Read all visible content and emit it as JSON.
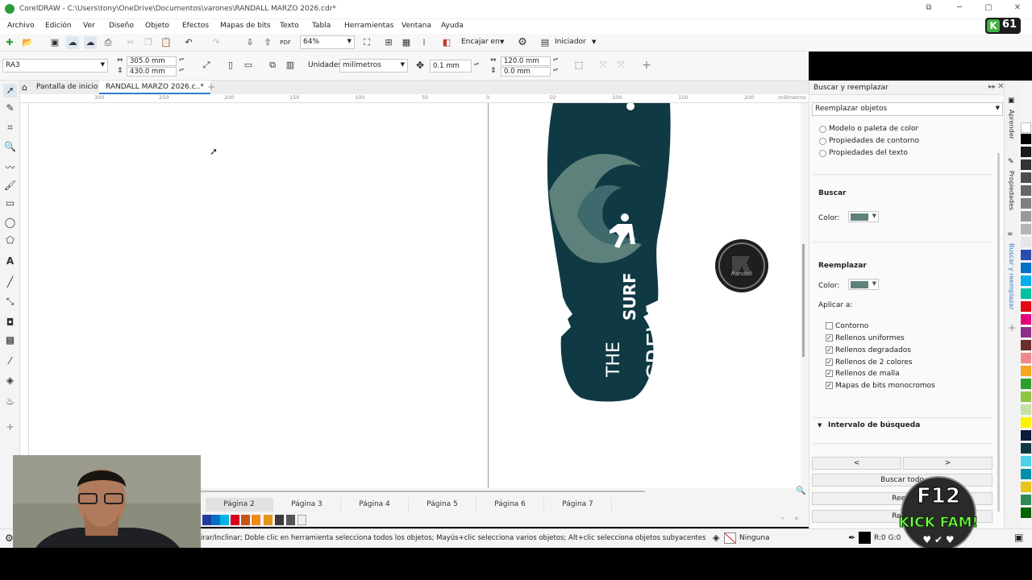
{
  "window": {
    "title": "CorelDRAW - C:\\Users\\tony\\OneDrive\\Documentos\\varones\\RANDALL MARZO 2026.cdr*"
  },
  "menu": [
    "Archivo",
    "Edición",
    "Ver",
    "Diseño",
    "Objeto",
    "Efectos",
    "Mapas de bits",
    "Texto",
    "Tabla",
    "Herramientas",
    "Ventana",
    "Ayuda"
  ],
  "badge": {
    "letter": "K",
    "count": "61"
  },
  "standard": {
    "zoom": "64%",
    "snap_label": "Encajar en",
    "launch_label": "Iniciador"
  },
  "property": {
    "paper": "RA3",
    "width": "305.0 mm",
    "height": "430.0 mm",
    "units_label": "Unidades:",
    "units": "milímetros",
    "nudge": "0.1 mm",
    "dup_x": "120.0 mm",
    "dup_y": "0.0 mm"
  },
  "doc_tabs": {
    "home": "Pantalla de inicio",
    "active": "RANDALL MARZO 2026.c..*"
  },
  "ruler": {
    "unit": "milímetros",
    "ticks": [
      "300",
      "250",
      "200",
      "150",
      "100",
      "50",
      "0",
      "50",
      "100",
      "150",
      "200"
    ]
  },
  "artwork": {
    "line1": "THE",
    "line2": "SURF",
    "line3": "CREW",
    "logo_text": "Randall"
  },
  "pages": [
    "Página 2",
    "Página 3",
    "Página 4",
    "Página 5",
    "Página 6",
    "Página 7"
  ],
  "status": {
    "hint": "irar/Inclinar; Doble clic en herramienta selecciona todos los objetos; Mayús+clic selecciona varios objetos; Alt+clic selecciona objetos subyacentes",
    "fill": "Ninguna",
    "rgb": "R:0 G:0"
  },
  "docker": {
    "title": "Buscar y reemplazar",
    "mode": "Reemplazar objetos",
    "options": [
      "Modelo o paleta de color",
      "Propiedades de contorno",
      "Propiedades del texto"
    ],
    "find_heading": "Buscar",
    "find_color_label": "Color:",
    "replace_heading": "Reemplazar",
    "replace_color_label": "Color:",
    "apply_label": "Aplicar a:",
    "apply": [
      {
        "label": "Contorno",
        "checked": false
      },
      {
        "label": "Rellenos uniformes",
        "checked": true
      },
      {
        "label": "Rellenos degradados",
        "checked": true
      },
      {
        "label": "Rellenos de 2 colores",
        "checked": true
      },
      {
        "label": "Rellenos de malla",
        "checked": true
      },
      {
        "label": "Mapas de bits monocromos",
        "checked": true
      }
    ],
    "range": "Intervalo de búsqueda",
    "prev": "<",
    "next": ">",
    "find_all": "Buscar todo",
    "replace": "Reem",
    "replace_all": "Reem"
  },
  "side_tabs": [
    "Aprender",
    "Propiedades",
    "Buscar y reemplazar"
  ],
  "watermark": {
    "line1": "F12",
    "line2": "KICK FAM!"
  },
  "colors": {
    "sole": "#0f3a44",
    "accent": "#5e827b",
    "find": "#5e827b"
  }
}
